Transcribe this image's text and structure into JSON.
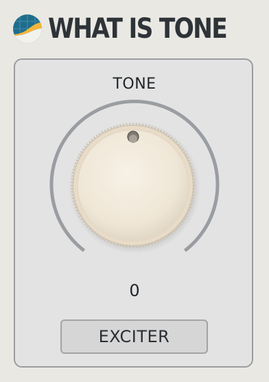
{
  "header": {
    "title": "WHAT IS TONE",
    "logo_icon": "waveform-logo-icon"
  },
  "knob": {
    "label": "TONE",
    "value": "0",
    "value_fraction": 0.5
  },
  "buttons": {
    "exciter_label": "EXCITER"
  },
  "colors": {
    "background": "#e9e8e3",
    "panel": "#e3e3e3",
    "title": "#2e3338",
    "knob_cap": "#f0e7d8",
    "arc": "#9a9da1",
    "logo_blue": "#1f6d8c",
    "logo_yellow": "#f2b63a"
  }
}
